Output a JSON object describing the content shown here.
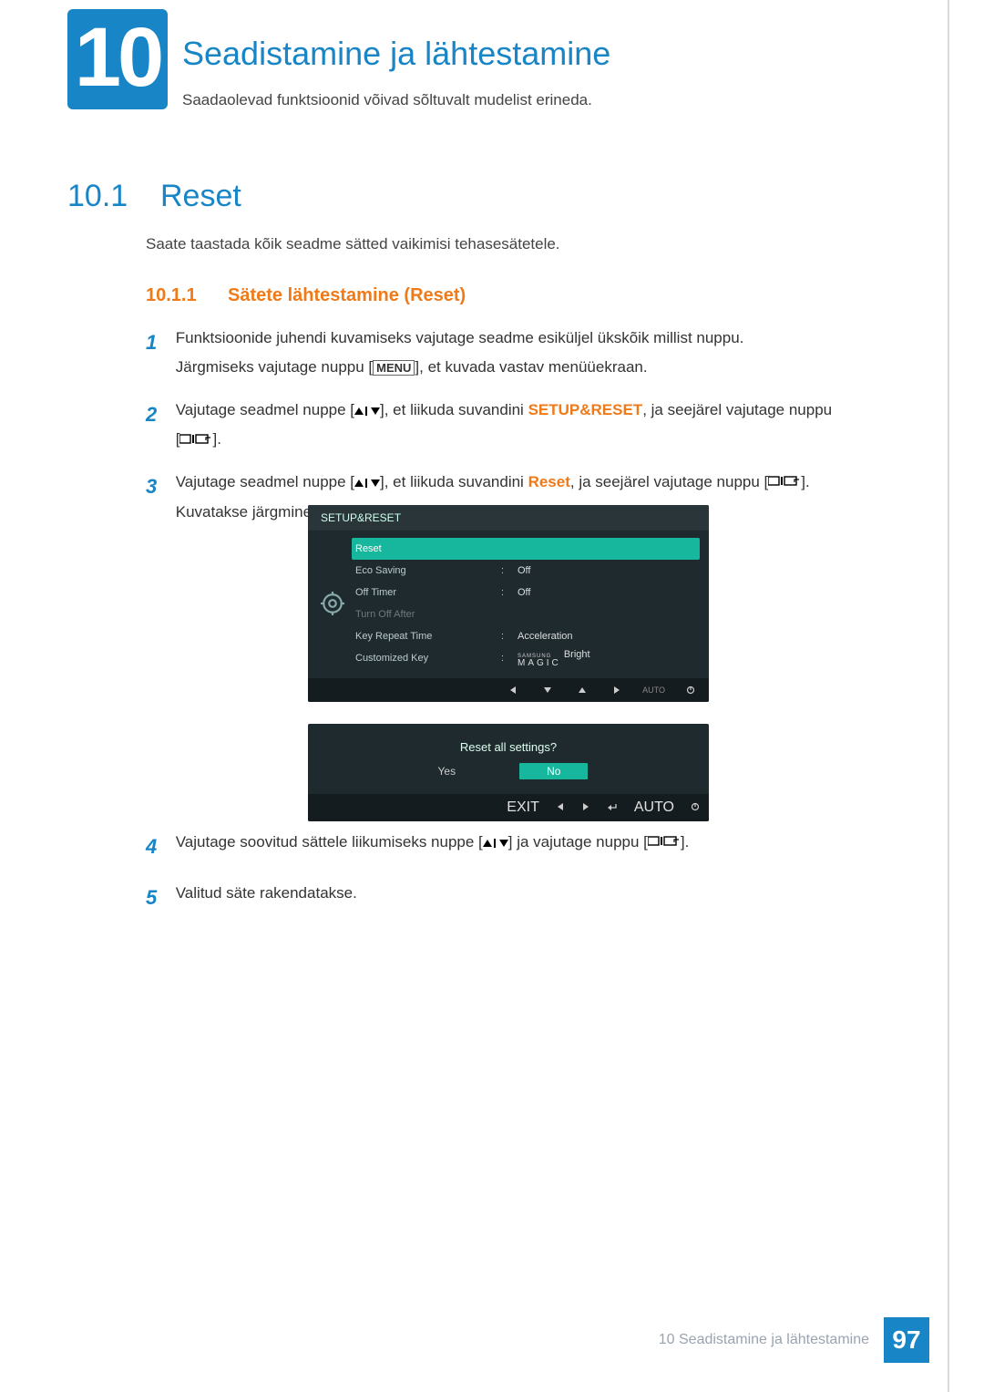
{
  "chapter": {
    "number": "10",
    "title": "Seadistamine ja lähtestamine",
    "subtitle": "Saadaolevad funktsioonid võivad sõltuvalt mudelist erineda."
  },
  "section": {
    "number": "10.1",
    "title": "Reset",
    "intro": "Saate taastada kõik seadme sätted vaikimisi tehasesätetele."
  },
  "subsection": {
    "number": "10.1.1",
    "title": "Sätete lähtestamine (Reset)"
  },
  "steps": {
    "s1": {
      "num": "1",
      "line1": "Funktsioonide juhendi kuvamiseks vajutage seadme esiküljel ükskõik millist nuppu.",
      "line2a": "Järgmiseks vajutage nuppu [",
      "menu": "MENU",
      "line2b": "], et kuvada vastav menüüekraan."
    },
    "s2": {
      "num": "2",
      "a": "Vajutage seadmel nuppe [",
      "b": "], et liikuda suvandini ",
      "target": "SETUP&RESET",
      "c": ", ja seejärel vajutage nuppu",
      "d": "[",
      "e": "]."
    },
    "s3": {
      "num": "3",
      "a": "Vajutage seadmel nuppe [",
      "b": "], et liikuda suvandini ",
      "target": "Reset",
      "c": ", ja seejärel vajutage nuppu [",
      "d": "].",
      "e": "Kuvatakse järgmine ekraan."
    },
    "s4": {
      "num": "4",
      "a": "Vajutage soovitud sättele liikumiseks nuppe [",
      "b": "] ja vajutage nuppu [",
      "c": "]."
    },
    "s5": {
      "num": "5",
      "text": "Valitud säte rakendatakse."
    }
  },
  "osd": {
    "title": "SETUP&RESET",
    "rows": {
      "reset": "Reset",
      "eco": "Eco Saving",
      "eco_v": "Off",
      "offtimer": "Off Timer",
      "offtimer_v": "Off",
      "turnoff": "Turn Off After",
      "keyrepeat": "Key Repeat Time",
      "keyrepeat_v": "Acceleration",
      "custom": "Customized Key",
      "custom_v": "Bright",
      "samsung": "SAMSUNG",
      "magic": "MAGIC"
    },
    "footer": {
      "auto": "AUTO"
    }
  },
  "dialog": {
    "question": "Reset all settings?",
    "yes": "Yes",
    "no": "No",
    "exit": "EXIT",
    "auto": "AUTO"
  },
  "footer": {
    "text": "10 Seadistamine ja lähtestamine",
    "page": "97"
  }
}
